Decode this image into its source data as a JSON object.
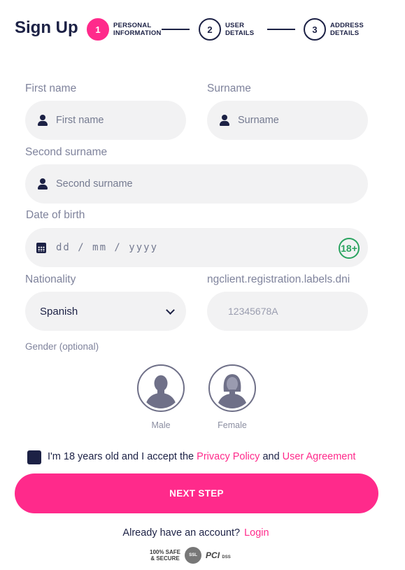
{
  "header": {
    "title": "Sign Up",
    "steps": [
      {
        "number": "1",
        "label_line1": "PERSONAL",
        "label_line2": "INFORMATION",
        "active": true
      },
      {
        "number": "2",
        "label_line1": "USER",
        "label_line2": "DETAILS",
        "active": false
      },
      {
        "number": "3",
        "label_line1": "ADDRESS",
        "label_line2": "DETAILS",
        "active": false
      }
    ]
  },
  "form": {
    "first_name": {
      "label": "First name",
      "placeholder": "First name",
      "value": ""
    },
    "surname": {
      "label": "Surname",
      "placeholder": "Surname",
      "value": ""
    },
    "second_surname": {
      "label": "Second surname",
      "placeholder": "Second surname",
      "value": ""
    },
    "dob": {
      "label": "Date of birth",
      "placeholder": "dd / mm / yyyy",
      "badge": "18+"
    },
    "nationality": {
      "label": "Nationality",
      "selected": "Spanish"
    },
    "dni": {
      "label": "ngclient.registration.labels.dni",
      "placeholder": "12345678A"
    },
    "gender": {
      "label": "Gender (optional)",
      "options": [
        "Male",
        "Female"
      ]
    },
    "terms": {
      "prefix": "I'm 18 years old and I accept the",
      "privacy_link": "Privacy Policy",
      "and": "and",
      "agreement_link": "User Agreement",
      "checked": true
    },
    "next_button": "NEXT STEP",
    "login_prompt": "Already have an account?",
    "login_link": "Login"
  },
  "trust": {
    "safe_line1": "100% SAFE",
    "safe_line2": "& SECURE",
    "ssl": "SSL",
    "pci": "PCI",
    "dss": "DSS"
  },
  "colors": {
    "accent": "#ff2a8b",
    "navy": "#1c2145",
    "field_bg": "#f2f2f3",
    "badge_green": "#2aa35f"
  }
}
